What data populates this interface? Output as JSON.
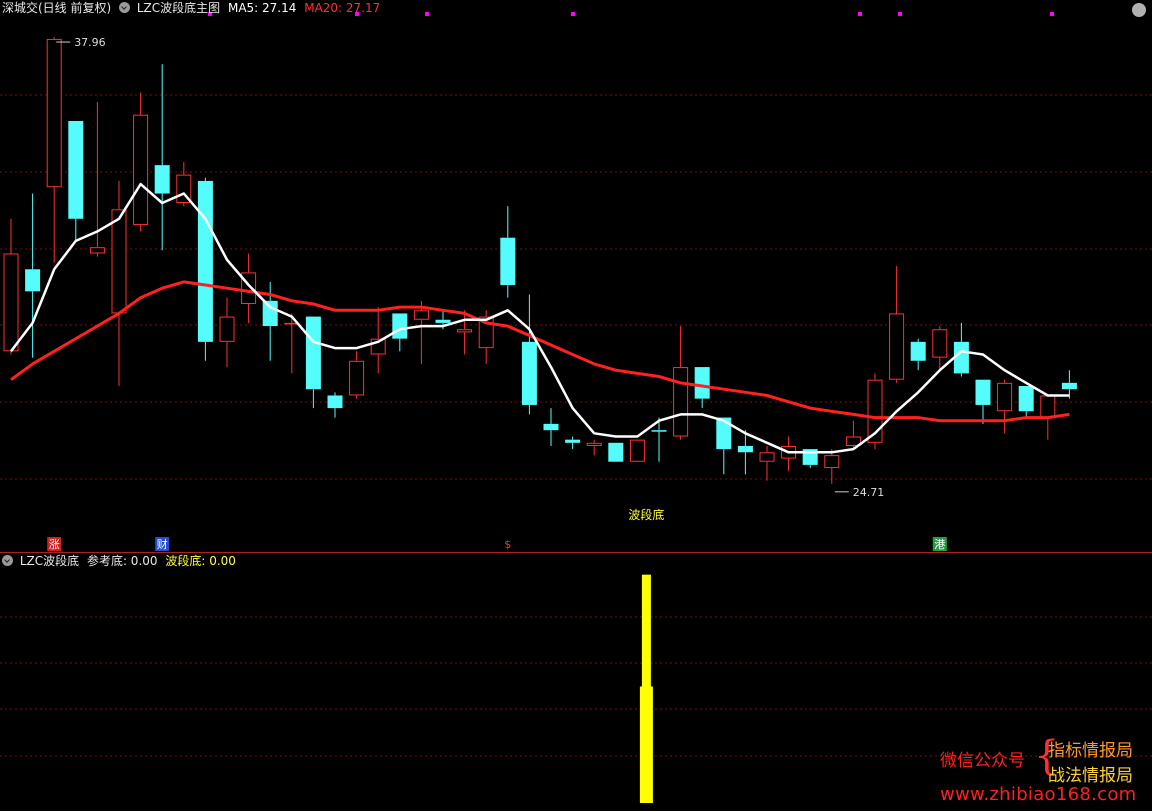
{
  "header": {
    "market_label": "深城交(日线 前复权)",
    "indicator_name": "LZC波段底主图",
    "ma5_label": "MA5: 27.14",
    "ma20_label": "MA20: 27.17"
  },
  "sub_header": {
    "name": "LZC波段底",
    "ref_label": "参考底: 0.00",
    "wave_label": "波段底: 0.00"
  },
  "watermark": {
    "line1": "微信公众号",
    "line2": "指标情报局",
    "line3": "战法情报局",
    "url": "www.zhibiao168.com"
  },
  "colors": {
    "up": "#ff3030",
    "down": "#54fcfc",
    "ma5": "#ffffff",
    "ma20": "#ff2020",
    "grid": "#7a1010",
    "indicator_bar": "#ffff00",
    "marker": "#ff00ff",
    "background": "#000000"
  },
  "chart_data": [
    {
      "type": "candlestick",
      "title": "LZC波段底主图",
      "ylim": [
        22.4,
        38.5
      ],
      "price_range_labels": {
        "high": "37.96",
        "low": "24.71"
      },
      "annotation": "波段底",
      "candles": [
        {
          "o": 28.0,
          "h": 32.2,
          "l": 27.9,
          "c": 31.1,
          "d": "up"
        },
        {
          "o": 30.6,
          "h": 33.0,
          "l": 27.8,
          "c": 29.9,
          "d": "down"
        },
        {
          "o": 33.2,
          "h": 37.96,
          "l": 30.8,
          "c": 37.9,
          "d": "up"
        },
        {
          "o": 35.3,
          "h": 35.3,
          "l": 31.5,
          "c": 32.2,
          "d": "down"
        },
        {
          "o": 31.1,
          "h": 35.9,
          "l": 31.0,
          "c": 31.3,
          "d": "up"
        },
        {
          "o": 29.2,
          "h": 33.4,
          "l": 26.9,
          "c": 32.5,
          "d": "up"
        },
        {
          "o": 32.0,
          "h": 36.2,
          "l": 31.8,
          "c": 35.5,
          "d": "up"
        },
        {
          "o": 33.9,
          "h": 37.1,
          "l": 31.2,
          "c": 33.0,
          "d": "down"
        },
        {
          "o": 32.7,
          "h": 34.0,
          "l": 32.6,
          "c": 33.6,
          "d": "up"
        },
        {
          "o": 33.4,
          "h": 33.5,
          "l": 27.7,
          "c": 28.3,
          "d": "down"
        },
        {
          "o": 28.3,
          "h": 29.7,
          "l": 27.5,
          "c": 29.1,
          "d": "up"
        },
        {
          "o": 29.5,
          "h": 31.1,
          "l": 28.9,
          "c": 30.5,
          "d": "up"
        },
        {
          "o": 29.6,
          "h": 30.2,
          "l": 27.7,
          "c": 28.8,
          "d": "down"
        },
        {
          "o": 28.9,
          "h": 29.2,
          "l": 27.3,
          "c": 28.9,
          "d": "up"
        },
        {
          "o": 29.1,
          "h": 29.1,
          "l": 26.2,
          "c": 26.8,
          "d": "down"
        },
        {
          "o": 26.6,
          "h": 26.7,
          "l": 25.9,
          "c": 26.2,
          "d": "down"
        },
        {
          "o": 26.6,
          "h": 28.0,
          "l": 26.5,
          "c": 27.7,
          "d": "up"
        },
        {
          "o": 27.9,
          "h": 29.4,
          "l": 27.3,
          "c": 28.4,
          "d": "up"
        },
        {
          "o": 29.2,
          "h": 29.2,
          "l": 28.0,
          "c": 28.4,
          "d": "down"
        },
        {
          "o": 29.0,
          "h": 29.6,
          "l": 27.6,
          "c": 29.3,
          "d": "up"
        },
        {
          "o": 28.9,
          "h": 29.3,
          "l": 28.7,
          "c": 29.0,
          "d": "down"
        },
        {
          "o": 28.6,
          "h": 29.3,
          "l": 27.9,
          "c": 28.7,
          "d": "up"
        },
        {
          "o": 28.1,
          "h": 29.3,
          "l": 27.6,
          "c": 29.1,
          "d": "up"
        },
        {
          "o": 31.6,
          "h": 32.6,
          "l": 29.7,
          "c": 30.1,
          "d": "down"
        },
        {
          "o": 28.3,
          "h": 29.8,
          "l": 26.0,
          "c": 26.3,
          "d": "down"
        },
        {
          "o": 25.7,
          "h": 26.2,
          "l": 25.0,
          "c": 25.5,
          "d": "down"
        },
        {
          "o": 25.2,
          "h": 25.3,
          "l": 24.9,
          "c": 25.1,
          "d": "down"
        },
        {
          "o": 25.0,
          "h": 25.2,
          "l": 24.7,
          "c": 25.1,
          "d": "up"
        },
        {
          "o": 25.1,
          "h": 25.1,
          "l": 24.5,
          "c": 24.5,
          "d": "down"
        },
        {
          "o": 24.5,
          "h": 25.2,
          "l": 24.5,
          "c": 25.2,
          "d": "up"
        },
        {
          "o": 25.5,
          "h": 25.9,
          "l": 24.5,
          "c": 25.5,
          "d": "down"
        },
        {
          "o": 25.3,
          "h": 28.8,
          "l": 25.2,
          "c": 27.5,
          "d": "up"
        },
        {
          "o": 27.5,
          "h": 27.5,
          "l": 26.2,
          "c": 26.5,
          "d": "down"
        },
        {
          "o": 25.9,
          "h": 25.9,
          "l": 24.1,
          "c": 24.9,
          "d": "down"
        },
        {
          "o": 25.0,
          "h": 25.5,
          "l": 24.1,
          "c": 24.8,
          "d": "down"
        },
        {
          "o": 24.5,
          "h": 25.0,
          "l": 23.9,
          "c": 24.8,
          "d": "up"
        },
        {
          "o": 24.6,
          "h": 25.3,
          "l": 24.2,
          "c": 25.0,
          "d": "up"
        },
        {
          "o": 24.9,
          "h": 24.9,
          "l": 24.3,
          "c": 24.4,
          "d": "down"
        },
        {
          "o": 24.3,
          "h": 24.9,
          "l": 23.8,
          "c": 24.71,
          "d": "up"
        },
        {
          "o": 25.0,
          "h": 25.8,
          "l": 24.9,
          "c": 25.3,
          "d": "up"
        },
        {
          "o": 25.1,
          "h": 27.3,
          "l": 24.9,
          "c": 27.1,
          "d": "up"
        },
        {
          "o": 27.1,
          "h": 30.7,
          "l": 27.0,
          "c": 29.2,
          "d": "up"
        },
        {
          "o": 28.3,
          "h": 28.4,
          "l": 27.4,
          "c": 27.7,
          "d": "down"
        },
        {
          "o": 27.8,
          "h": 28.8,
          "l": 27.4,
          "c": 28.7,
          "d": "up"
        },
        {
          "o": 28.3,
          "h": 28.9,
          "l": 27.2,
          "c": 27.3,
          "d": "down"
        },
        {
          "o": 27.1,
          "h": 27.1,
          "l": 25.7,
          "c": 26.3,
          "d": "down"
        },
        {
          "o": 26.1,
          "h": 27.1,
          "l": 25.4,
          "c": 27.0,
          "d": "up"
        },
        {
          "o": 26.9,
          "h": 26.9,
          "l": 25.9,
          "c": 26.1,
          "d": "down"
        },
        {
          "o": 25.9,
          "h": 26.5,
          "l": 25.2,
          "c": 26.6,
          "d": "up"
        },
        {
          "o": 27.0,
          "h": 27.4,
          "l": 26.5,
          "c": 26.8,
          "d": "down"
        }
      ],
      "ma5": [
        28.0,
        28.9,
        30.6,
        31.5,
        31.8,
        32.2,
        33.3,
        32.7,
        33.0,
        32.2,
        30.9,
        30.1,
        29.4,
        29.1,
        28.3,
        28.1,
        28.1,
        28.3,
        28.7,
        28.8,
        28.8,
        29.0,
        29.0,
        29.3,
        28.7,
        27.5,
        26.2,
        25.4,
        25.3,
        25.3,
        25.8,
        26.0,
        26.0,
        25.8,
        25.4,
        25.1,
        24.8,
        24.8,
        24.8,
        24.9,
        25.4,
        26.1,
        26.7,
        27.4,
        28.0,
        27.9,
        27.4,
        27.0,
        26.6,
        26.6
      ],
      "ma20": [
        27.1,
        27.6,
        28.0,
        28.4,
        28.8,
        29.2,
        29.7,
        30.0,
        30.2,
        30.1,
        30.0,
        29.9,
        29.8,
        29.6,
        29.5,
        29.3,
        29.3,
        29.3,
        29.4,
        29.4,
        29.3,
        29.2,
        28.9,
        28.8,
        28.5,
        28.2,
        27.9,
        27.6,
        27.4,
        27.3,
        27.2,
        27.0,
        26.9,
        26.8,
        26.7,
        26.6,
        26.4,
        26.2,
        26.1,
        26.0,
        25.9,
        25.9,
        25.9,
        25.8,
        25.8,
        25.8,
        25.8,
        25.9,
        25.9,
        26.0
      ],
      "event_labels": [
        {
          "text": "涨",
          "index": 2,
          "bg": "#d02020"
        },
        {
          "text": "财",
          "index": 7,
          "bg": "#2050d0"
        },
        {
          "text": "$",
          "index": 23,
          "bg": "",
          "color": "#ff3030"
        },
        {
          "text": "港",
          "index": 43,
          "bg": "#20a040"
        }
      ]
    },
    {
      "type": "bar",
      "title": "LZC波段底",
      "ylim": [
        0,
        1
      ],
      "series": [
        {
          "name": "参考底",
          "values": [
            {
              "index": 29,
              "value": 0.98
            }
          ]
        },
        {
          "name": "波段底",
          "values": [
            {
              "index": 29,
              "value": 0.5
            }
          ]
        }
      ]
    }
  ]
}
